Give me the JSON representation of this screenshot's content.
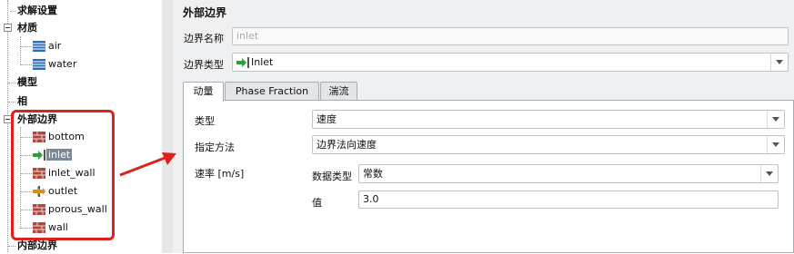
{
  "tree": {
    "solver_settings": "求解设置",
    "material": {
      "label": "材质",
      "items": [
        "air",
        "water"
      ]
    },
    "model": "模型",
    "phase": "相",
    "external_boundaries": {
      "label": "外部边界",
      "items": [
        "bottom",
        "inlet",
        "inlet_wall",
        "outlet",
        "porous_wall",
        "wall"
      ],
      "selected": "inlet"
    },
    "internal_boundaries": "内部边界"
  },
  "panel": {
    "title": "外部边界",
    "name_label": "边界名称",
    "name_value": "inlet",
    "type_label": "边界类型",
    "type_value": "Inlet",
    "tabs": [
      "动量",
      "Phase Fraction",
      "湍流"
    ],
    "active_tab": "动量",
    "momentum": {
      "type_label": "类型",
      "type_value": "速度",
      "method_label": "指定方法",
      "method_value": "边界法向速度",
      "rate_label": "速率 [m/s]",
      "data_type_label": "数据类型",
      "data_type_value": "常数",
      "value_label": "值",
      "value": "3.0"
    }
  },
  "colors": {
    "highlight_box": "#e0201a",
    "arrow": "#e0201a",
    "selected_bg": "#7b8896",
    "material_icon": "#2f6fb5",
    "wall_icon": "#b0463c",
    "inlet_icon": "#2e9e3a",
    "outlet_icon": "#d8901c"
  },
  "icons": {
    "material": "material-grid-icon",
    "wall": "brick-wall-icon",
    "inlet": "green-arrow-into-bar-icon",
    "outlet": "orange-arrow-out-bar-icon"
  }
}
